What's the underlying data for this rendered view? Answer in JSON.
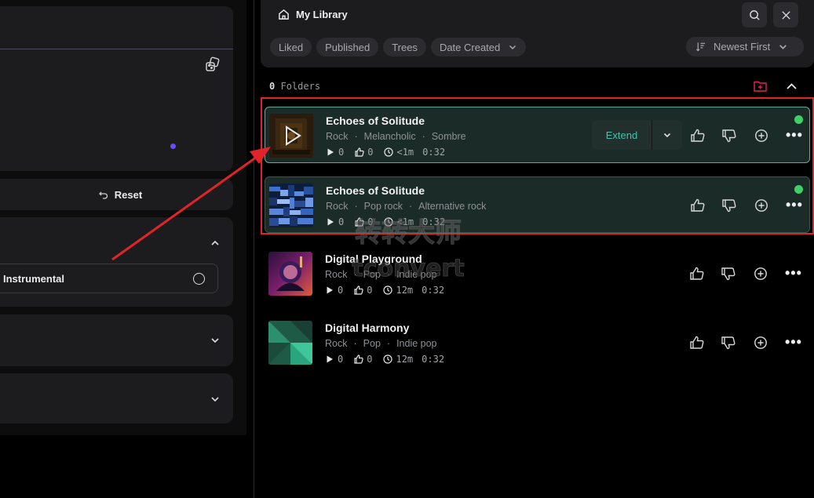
{
  "left_panel": {
    "reset_label": "Reset",
    "instrumental_label": "Instrumental"
  },
  "library": {
    "title": "My Library",
    "filters": [
      "Liked",
      "Published",
      "Trees",
      "Date Created"
    ],
    "sort_label": "Newest First",
    "folders_count": "0",
    "folders_label": "Folders"
  },
  "songs": [
    {
      "title": "Echoes of Solitude",
      "tags": [
        "Rock",
        "Melancholic",
        "Sombre"
      ],
      "plays": "0",
      "likes": "0",
      "age": "<1m",
      "duration": "0:32",
      "extend_label": "Extend"
    },
    {
      "title": "Echoes of Solitude",
      "tags": [
        "Rock",
        "Pop rock",
        "Alternative rock"
      ],
      "plays": "0",
      "likes": "0",
      "age": "<1m",
      "duration": "0:32"
    },
    {
      "title": "Digital Playground",
      "tags": [
        "Rock",
        "Pop",
        "Indie pop"
      ],
      "plays": "0",
      "likes": "0",
      "age": "12m",
      "duration": "0:32"
    },
    {
      "title": "Digital Harmony",
      "tags": [
        "Rock",
        "Pop",
        "Indie pop"
      ],
      "plays": "0",
      "likes": "0",
      "age": "12m",
      "duration": "0:32"
    }
  ],
  "watermark": {
    "line1": "转转大师",
    "line2": "tconvert"
  },
  "colors": {
    "accent_teal": "#48c0ae",
    "live_dot": "#3fd167",
    "annotation_red": "#e2232a",
    "folder_add": "#e0245e"
  }
}
